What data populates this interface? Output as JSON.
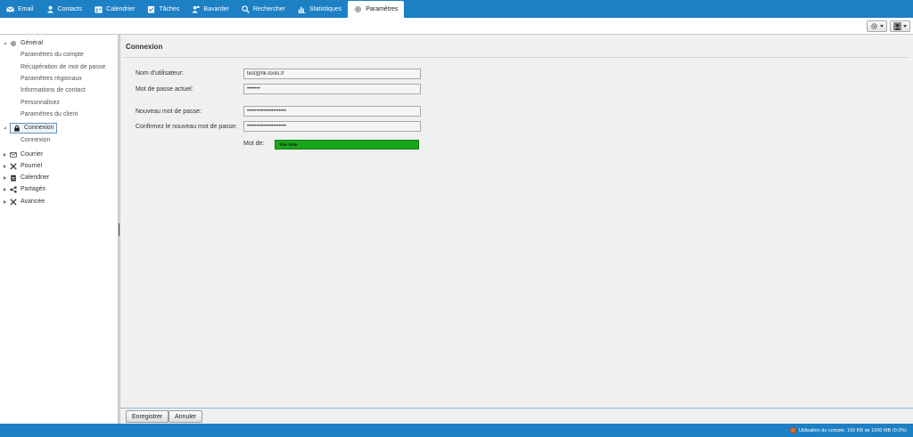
{
  "nav": {
    "tabs": [
      {
        "label": "Email",
        "icon": "mail-icon"
      },
      {
        "label": "Contacts",
        "icon": "contacts-icon"
      },
      {
        "label": "Calendrier",
        "icon": "calendar-icon"
      },
      {
        "label": "Tâches",
        "icon": "tasks-icon"
      },
      {
        "label": "Bavarder",
        "icon": "chat-icon"
      },
      {
        "label": "Rechercher",
        "icon": "search-icon"
      },
      {
        "label": "Statistiques",
        "icon": "chart-icon"
      },
      {
        "label": "Paramètres",
        "icon": "gear-icon",
        "active": true
      }
    ]
  },
  "sidebar": {
    "general": {
      "label": "Général",
      "icon": "gear-icon",
      "expanded": true
    },
    "general_items": [
      "Paramètres du compte",
      "Récupération de mot de passe",
      "Paramètres régionaux",
      "Informations de contact",
      "Personnalisez",
      "Paramètres du client"
    ],
    "connexion": {
      "label": "Connexion",
      "icon": "lock-icon",
      "selected": true
    },
    "connexion_items": [
      "Connexion"
    ],
    "sections": [
      {
        "label": "Courrier",
        "icon": "envelope-icon"
      },
      {
        "label": "Pourriel",
        "icon": "tools-icon"
      },
      {
        "label": "Calendrier",
        "icon": "calendar-icon"
      },
      {
        "label": "Partagés",
        "icon": "share-icon"
      },
      {
        "label": "Avancée",
        "icon": "tools-icon"
      }
    ]
  },
  "main": {
    "title": "Connexion",
    "fields": {
      "username_label": "Nom d'utilisateur:",
      "username_value": "test@flk-tools.fr",
      "current_password_label": "Mot de passe actuel:",
      "current_password_value": "•••••••",
      "new_password_label": "Nouveau mot de passe:",
      "new_password_value": "•••••••••••••••••••••",
      "confirm_password_label": "Confirmez le nouveau mot de passe:",
      "confirm_password_value": "•••••••••••••••••••••",
      "strength_label": "Mot de:",
      "strength_value": "Très forte",
      "strength_fraction": 1.0
    }
  },
  "footer": {
    "save_label": "Enregistrer",
    "cancel_label": "Annuler"
  },
  "status": {
    "text": "Utilisation du compte: 109 KB de 1000 MB (0.0%)"
  },
  "colors": {
    "brand_blue": "#1d7fc4",
    "strength_green": "#1aa51a",
    "panel_bg": "#f0f0f0"
  }
}
